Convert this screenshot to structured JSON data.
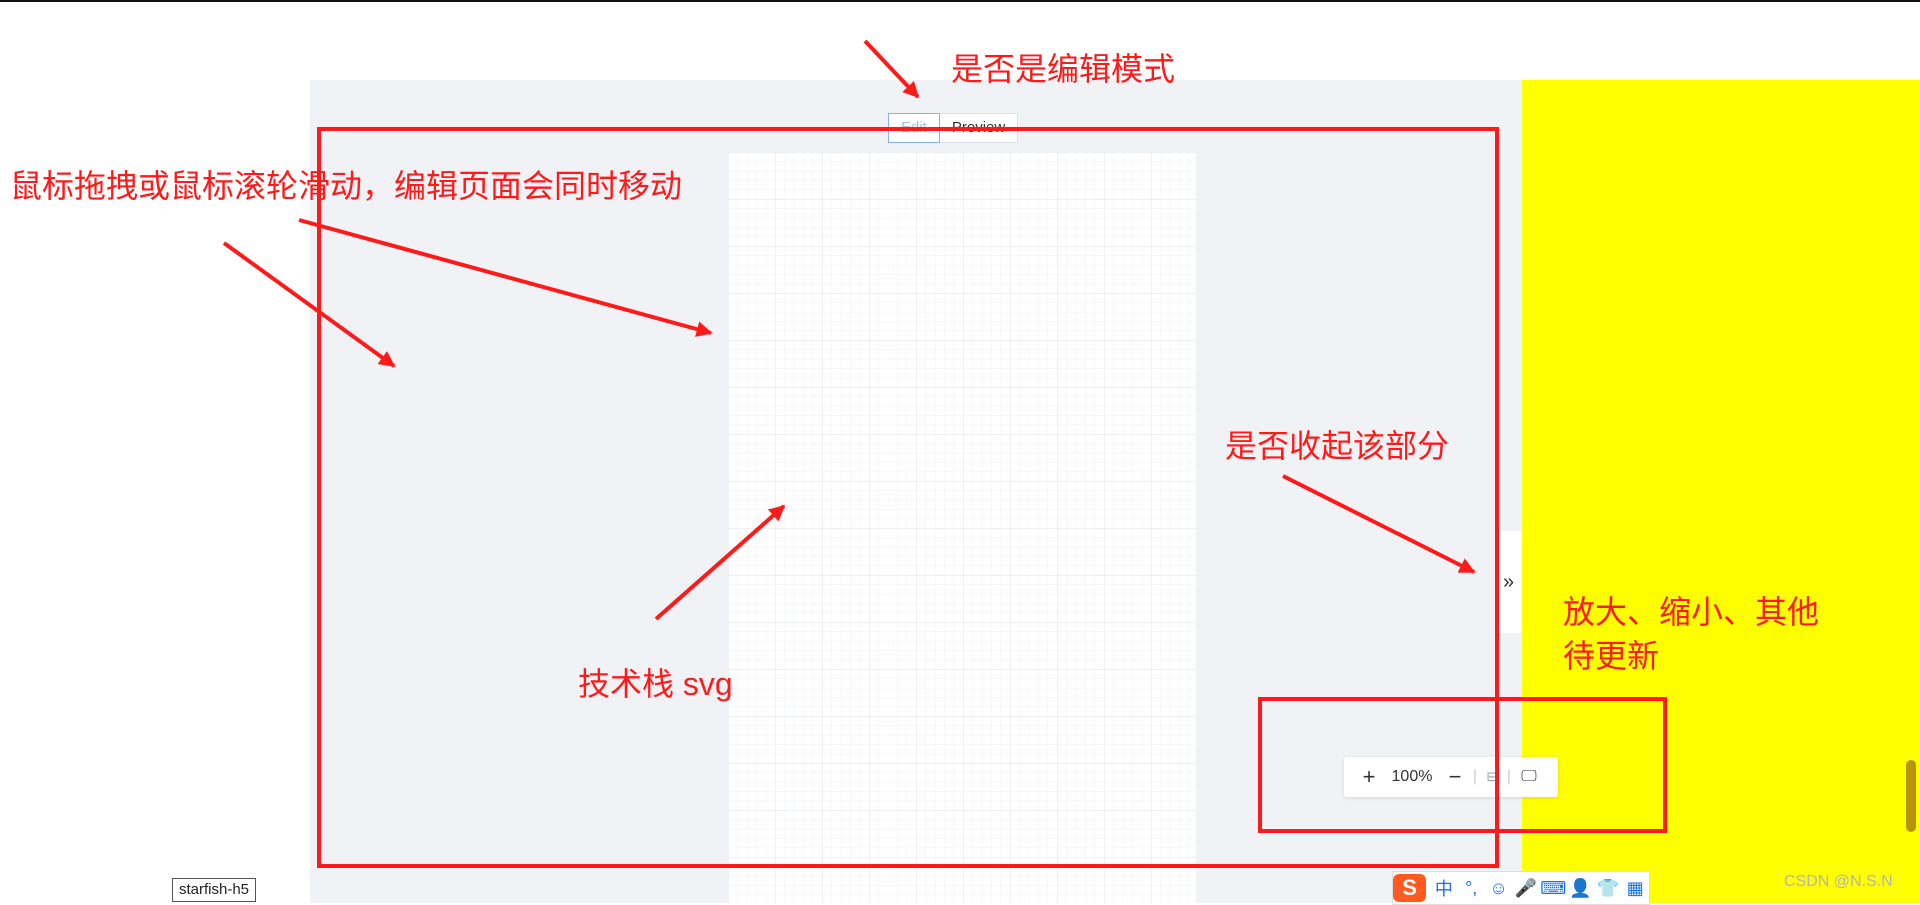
{
  "mode_switch": {
    "edit_label": "Edit",
    "preview_label": "Preview"
  },
  "workspace": {
    "collapse_icon": "»"
  },
  "zoom_toolbar": {
    "plus_label": "+",
    "zoom_level": "100%",
    "minus_label": "−",
    "separator": "|",
    "fit_icon": "⊟",
    "fullscreen_icon": "🖵"
  },
  "annotations": {
    "edit_mode": "是否是编辑模式",
    "drag_scroll": "鼠标拖拽或鼠标滚轮滑动，编辑页面会同时移动",
    "collapse": "是否收起该部分",
    "tech_stack": "技术栈 svg",
    "zoom_line1": "放大、缩小、其他",
    "zoom_line2": "待更新"
  },
  "tooltip": {
    "text": "starfish-h5"
  },
  "ime": {
    "logo": "S",
    "items": [
      "中",
      "°,",
      "☺",
      "🎤",
      "⌨",
      "👤",
      "👕",
      "▦"
    ]
  },
  "watermark": "CSDN @N.S.N",
  "colors": {
    "annotation": "#ff1a1a",
    "workspace_bg": "#f0f2f5",
    "right_panel": "#ffff00",
    "grid_line": "#e4e6ea"
  }
}
